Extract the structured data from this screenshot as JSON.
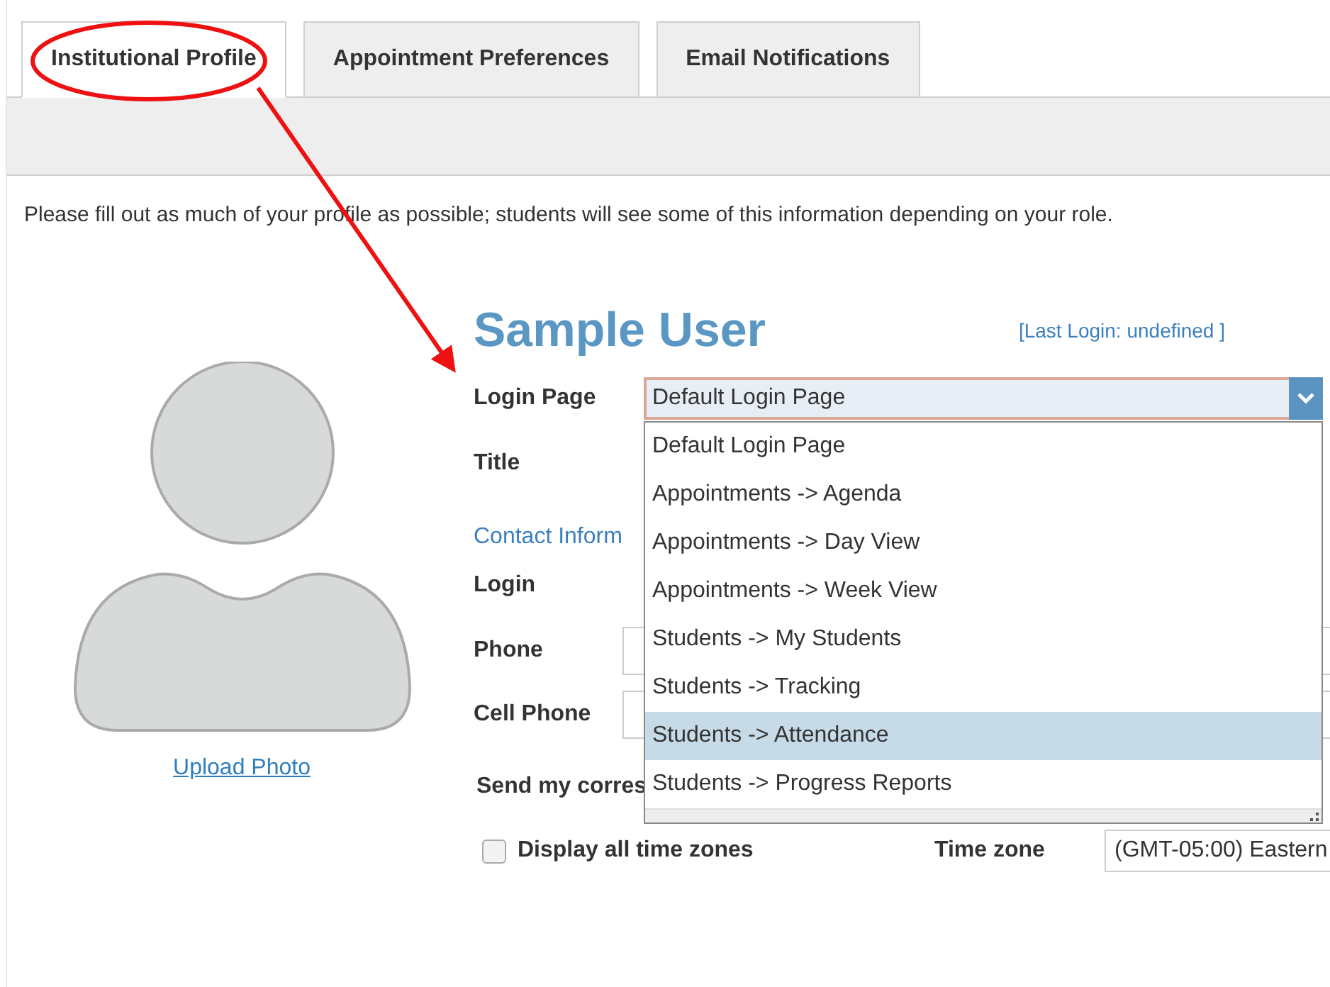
{
  "tabs": [
    {
      "label": "Institutional Profile",
      "selected": true
    },
    {
      "label": "Appointment Preferences",
      "selected": false
    },
    {
      "label": "Email Notifications",
      "selected": false
    }
  ],
  "message": "Please fill out as much of your profile as possible; students will see some of this information depending on your role.",
  "profile": {
    "name": "Sample User",
    "last_login": "[Last Login: undefined ]",
    "upload_link": "Upload Photo"
  },
  "login_page": {
    "label": "Login Page",
    "value": "Default Login Page",
    "expanded": true,
    "options": [
      {
        "label": "Default Login Page",
        "highlighted": false
      },
      {
        "label": "Appointments -> Agenda",
        "highlighted": false
      },
      {
        "label": "Appointments -> Day View",
        "highlighted": false
      },
      {
        "label": "Appointments -> Week View",
        "highlighted": false
      },
      {
        "label": "Students -> My Students",
        "highlighted": false
      },
      {
        "label": "Students -> Tracking",
        "highlighted": false
      },
      {
        "label": "Students -> Attendance",
        "highlighted": true
      },
      {
        "label": "Students -> Progress Reports",
        "highlighted": false
      }
    ]
  },
  "title_label": "Title",
  "contact_heading": "Contact Inform",
  "login_label": "Login",
  "phone_label": "Phone",
  "cell_phone_label": "Cell Phone",
  "send_label": "Send my corres",
  "display_all_time_zones": {
    "label": "Display all time zones",
    "checked": false
  },
  "time_zone": {
    "label": "Time zone",
    "value": "(GMT-05:00) Eastern"
  }
}
